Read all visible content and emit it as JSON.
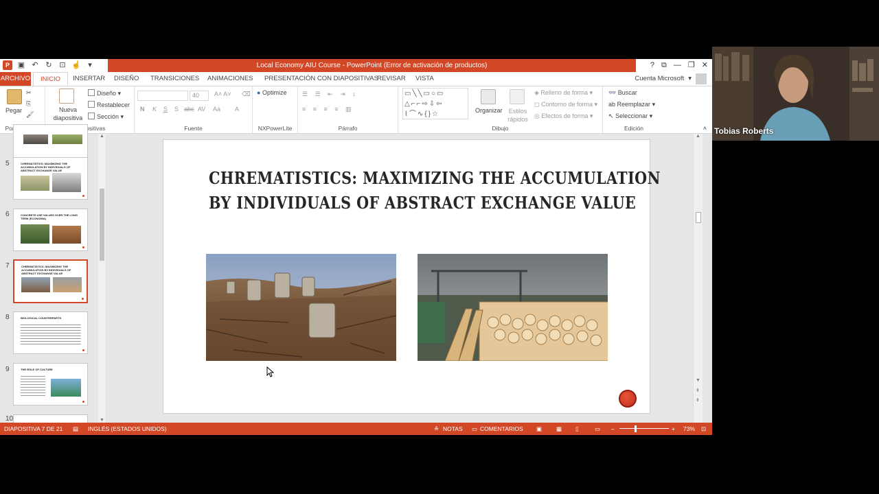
{
  "window": {
    "title": "Local Economy AIU Course -  PowerPoint (Error de activación de productos)",
    "controls": [
      "?",
      "⧉",
      "—",
      "❐",
      "✕"
    ]
  },
  "tabs": [
    {
      "label": "ARCHIVO"
    },
    {
      "label": "INICIO"
    },
    {
      "label": "INSERTAR"
    },
    {
      "label": "DISEÑO"
    },
    {
      "label": "TRANSICIONES"
    },
    {
      "label": "ANIMACIONES"
    },
    {
      "label": "PRESENTACIÓN CON DIAPOSITIVAS"
    },
    {
      "label": "REVISAR"
    },
    {
      "label": "VISTA"
    }
  ],
  "account": "Cuenta Microsoft",
  "ribbon": {
    "portapapeles": {
      "paste": "Pegar",
      "label": "Portapapeles"
    },
    "diapositivas": {
      "new": "Nueva diapositiva",
      "layout": "Diseño",
      "reset": "Restablecer",
      "section": "Sección",
      "label": "Diapositivas"
    },
    "fuente": {
      "size": "40",
      "label": "Fuente",
      "buttons": [
        "N",
        "K",
        "S",
        "S",
        "abc",
        "AV",
        "Aa",
        "A"
      ]
    },
    "nxpowerlite": {
      "optimize": "Optimize",
      "label": "NXPowerLite"
    },
    "parrafo": {
      "label": "Párrafo"
    },
    "dibujo": {
      "arrange": "Organizar",
      "styles": "Estilos rápidos",
      "fill": "Relleno de forma",
      "outline": "Contorno de forma",
      "effects": "Efectos de forma",
      "label": "Dibujo"
    },
    "edicion": {
      "find": "Buscar",
      "replace": "Reemplazar",
      "select": "Seleccionar",
      "label": "Edición"
    }
  },
  "thumbnails": [
    {
      "num": "5",
      "title": "CHREMATISTICS: MAXIMIZING THE ACCUMULATION BY INDIVIDUALS OF ABSTRACT EXCHANGE VALUE"
    },
    {
      "num": "6",
      "title": "CONCRETE USE VALUES OVER THE LONG TERM (ECONOMIA)"
    },
    {
      "num": "7",
      "title": "CHREMATISTICS: MAXIMIZING THE ACCUMULATION BY INDIVIDUALS OF ABSTRACT EXCHANGE VALUE"
    },
    {
      "num": "8",
      "title": "BIOLOGICAL COUNTERPARTS"
    },
    {
      "num": "9",
      "title": "THE ROLE OF CULTURE"
    },
    {
      "num": "10",
      "title": ""
    }
  ],
  "slide": {
    "title_line1": "CHREMATISTICS: MAXIMIZING THE ACCUMULATION",
    "title_line2": "BY INDIVIDUALS OF ABSTRACT EXCHANGE VALUE",
    "image_left": "clear-cut forest stumps",
    "image_right": "sawmill log yard"
  },
  "status": {
    "slide": "DIAPOSITIVA 7 DE 21",
    "language": "INGLÉS (ESTADOS UNIDOS)",
    "notes": "NOTAS",
    "comments": "COMENTARIOS",
    "zoom": "73%"
  },
  "webcam": {
    "name": "Tobias Roberts"
  },
  "colors": {
    "accent": "#d24726"
  }
}
